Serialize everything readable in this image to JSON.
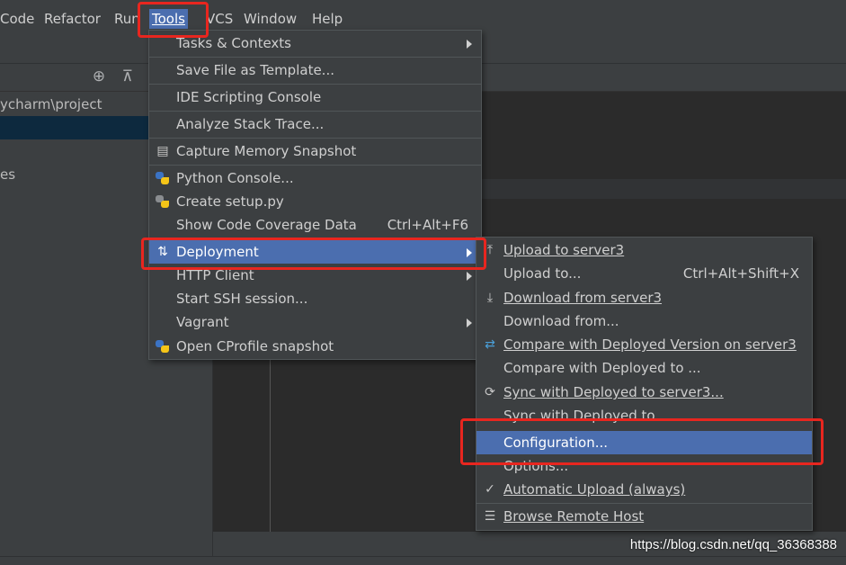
{
  "menubar": {
    "items": [
      {
        "label": "Code",
        "mnemonic": "C"
      },
      {
        "label": "Refactor",
        "mnemonic": "R"
      },
      {
        "label": "Run",
        "mnemonic": ""
      },
      {
        "label": "Tools",
        "mnemonic": "T"
      },
      {
        "label": "VCS",
        "mnemonic": ""
      },
      {
        "label": "Window",
        "mnemonic": "W"
      },
      {
        "label": "Help",
        "mnemonic": "H"
      }
    ],
    "active": "Tools"
  },
  "project_panel": {
    "path": "ycharm\\project",
    "rows": [
      "",
      "es"
    ]
  },
  "tools_menu": {
    "items": [
      {
        "label": "Tasks & Contexts",
        "submenu": true
      },
      {
        "label": "Save File as Template..."
      },
      {
        "label": "IDE Scripting Console"
      },
      {
        "label": "Analyze Stack Trace..."
      },
      {
        "label": "Capture Memory Snapshot",
        "icon": "memory-snapshot-icon"
      },
      {
        "label": "Python Console...",
        "icon": "python-icon"
      },
      {
        "label": "Create setup.py",
        "icon": "python-file-icon"
      },
      {
        "label": "Show Code Coverage Data",
        "shortcut": "Ctrl+Alt+F6"
      },
      {
        "label": "Deployment",
        "submenu": true,
        "icon": "deployment-arrows-icon",
        "highlighted": true
      },
      {
        "label": "HTTP Client",
        "submenu": true
      },
      {
        "label": "Start SSH session..."
      },
      {
        "label": "Vagrant",
        "submenu": true
      },
      {
        "label": "Open CProfile snapshot",
        "icon": "cprofile-icon"
      }
    ]
  },
  "deployment_menu": {
    "items": [
      {
        "label": "Upload to server3",
        "icon": "upload-icon"
      },
      {
        "label": "Upload to...",
        "shortcut": "Ctrl+Alt+Shift+X"
      },
      {
        "label": "Download from server3",
        "icon": "download-icon"
      },
      {
        "label": "Download from..."
      },
      {
        "label": "Compare with Deployed Version on server3",
        "icon": "compare-icon"
      },
      {
        "label": "Compare with Deployed to ..."
      },
      {
        "label": "Sync with Deployed to server3...",
        "icon": "sync-icon"
      },
      {
        "label": "Sync with Deployed to..."
      },
      {
        "label": "Configuration...",
        "highlighted": true
      },
      {
        "label": "Options..."
      },
      {
        "label": "Automatic Upload (always)",
        "icon": "checkmark-icon"
      },
      {
        "label": "Browse Remote Host",
        "icon": "server-icon"
      }
    ]
  },
  "watermark": "https://blog.csdn.net/qq_36368388",
  "colors": {
    "background": "#2b2b2b",
    "panel": "#3c3f41",
    "highlight": "#4b6eaf",
    "annotation": "#e8261f"
  }
}
